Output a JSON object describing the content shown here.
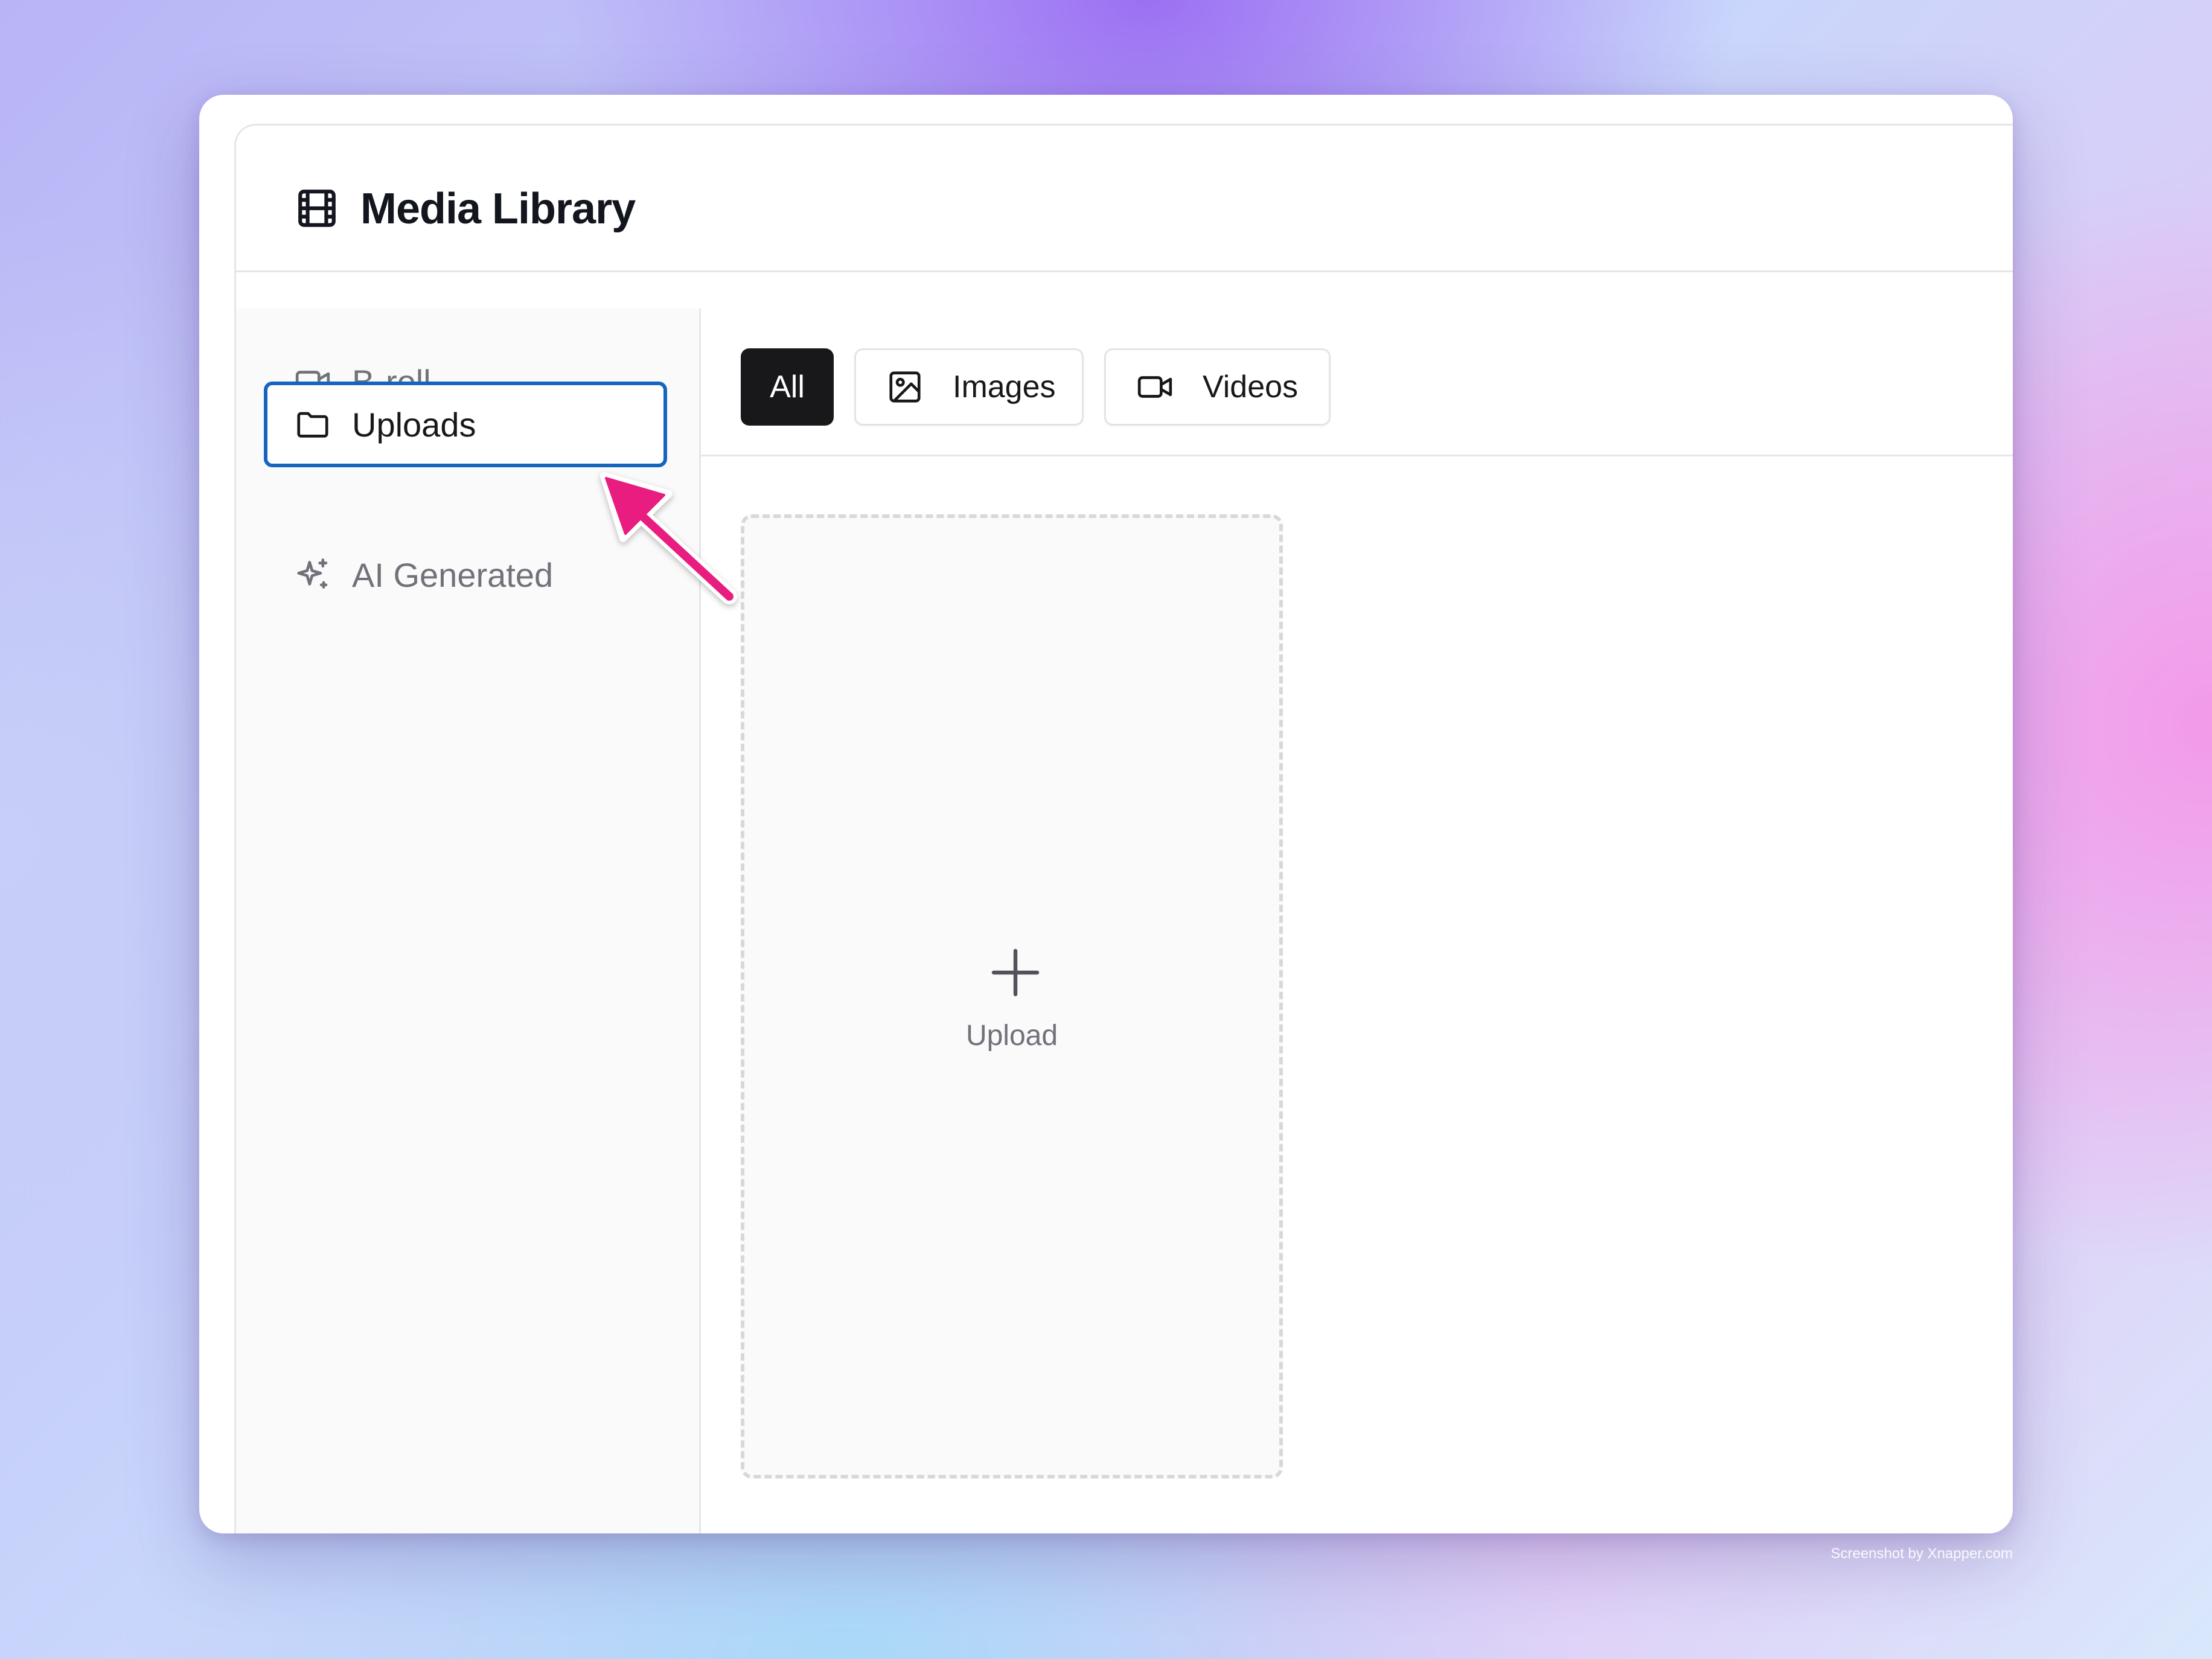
{
  "header": {
    "title": "Media Library",
    "icon": "film-icon"
  },
  "sidebar": {
    "items": [
      {
        "label": "B-roll",
        "icon": "video-camera-icon",
        "active": false
      },
      {
        "label": "Uploads",
        "icon": "folder-icon",
        "active": true
      },
      {
        "label": "AI Generated",
        "icon": "sparkles-icon",
        "active": false
      }
    ]
  },
  "filters": {
    "items": [
      {
        "label": "All",
        "selected": true
      },
      {
        "label": "Images",
        "icon": "image-icon",
        "selected": false
      },
      {
        "label": "Videos",
        "icon": "video-camera-icon",
        "selected": false
      }
    ]
  },
  "upload": {
    "label": "Upload",
    "icon": "plus-icon"
  },
  "annotation": {
    "color": "#e91e80",
    "target": "Uploads"
  },
  "watermark": "Screenshot by Xnapper.com",
  "colors": {
    "active_border": "#1565c0",
    "chip_selected_bg": "#18181b",
    "muted_text": "#71717a"
  }
}
